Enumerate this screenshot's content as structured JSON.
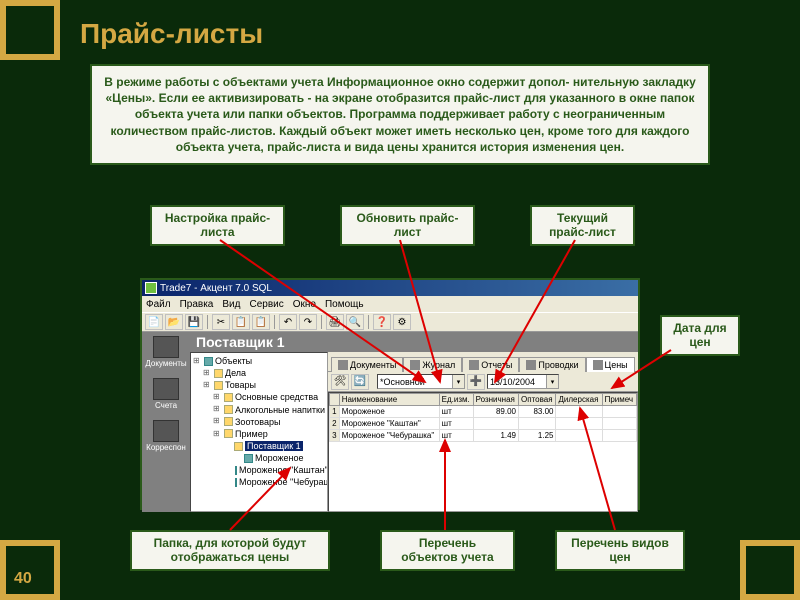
{
  "page_number": "40",
  "title": "Прайс-листы",
  "description": "В режиме работы с объектами учета Информационное окно содержит допол-\nнительную закладку «Цены». Если ее активизировать - на экране отобразится\nпрайс-лист для указанного в окне папок объекта учета или папки объектов.\nПрограмма поддерживает работу с неограниченным количеством прайс-листов.\nКаждый объект может иметь несколько цен, кроме того для каждого объекта учета,\nпрайс-листа и вида цены хранится история изменения цен.",
  "annotations": {
    "setup": "Настройка прайс-\nлиста",
    "update": "Обновить прайс-\nлист",
    "current": "Текущий\nпрайс-лист",
    "date": "Дата для\nцен",
    "folder": "Папка, для которой будут\nотображаться цены",
    "list": "Перечень\nобъектов учета",
    "types": "Перечень видов\nцен"
  },
  "app": {
    "title": "Trade7 - Акцент 7.0 SQL",
    "menubar": [
      "Файл",
      "Правка",
      "Вид",
      "Сервис",
      "Окно",
      "Помощь"
    ],
    "outlook": [
      "Документы",
      "Счета",
      "Корреспон"
    ],
    "supplier_header": "Поставщик 1",
    "tree": [
      {
        "lvl": 0,
        "icon": "cube",
        "label": "Объекты"
      },
      {
        "lvl": 1,
        "icon": "fld",
        "label": "Дела"
      },
      {
        "lvl": 1,
        "icon": "fld",
        "label": "Товары"
      },
      {
        "lvl": 2,
        "icon": "fld",
        "label": "Основные средства"
      },
      {
        "lvl": 2,
        "icon": "fld",
        "label": "Алкогольные напитки"
      },
      {
        "lvl": 2,
        "icon": "fld",
        "label": "Зоотовары"
      },
      {
        "lvl": 2,
        "icon": "fld",
        "label": "Пример"
      },
      {
        "lvl": 3,
        "icon": "fld",
        "label": "Поставщик 1",
        "selected": true
      },
      {
        "lvl": 4,
        "icon": "cube",
        "label": "Мороженое"
      },
      {
        "lvl": 4,
        "icon": "cube",
        "label": "Мороженое \"Каштан\""
      },
      {
        "lvl": 4,
        "icon": "cube",
        "label": "Мороженое \"Чебурашка\""
      }
    ],
    "tabs": [
      {
        "label": "Документы"
      },
      {
        "label": "Журнал"
      },
      {
        "label": "Отчеты"
      },
      {
        "label": "Проводки"
      },
      {
        "label": "Цены",
        "active": true
      }
    ],
    "subbar": {
      "price_list_combo": "*Основной",
      "date_combo": "13/10/2004"
    },
    "grid": {
      "columns": [
        "",
        "Наименование",
        "Ед.изм.",
        "Розничная",
        "Оптовая",
        "Дилерская",
        "Примеч"
      ],
      "rows": [
        [
          "1",
          "Мороженое",
          "шт",
          "89.00",
          "83.00",
          "",
          ""
        ],
        [
          "2",
          "Мороженое \"Каштан\"",
          "шт",
          "",
          "",
          "",
          ""
        ],
        [
          "3",
          "Мороженое \"Чебурашка\"",
          "шт",
          "1.49",
          "1.25",
          "",
          ""
        ]
      ]
    }
  }
}
